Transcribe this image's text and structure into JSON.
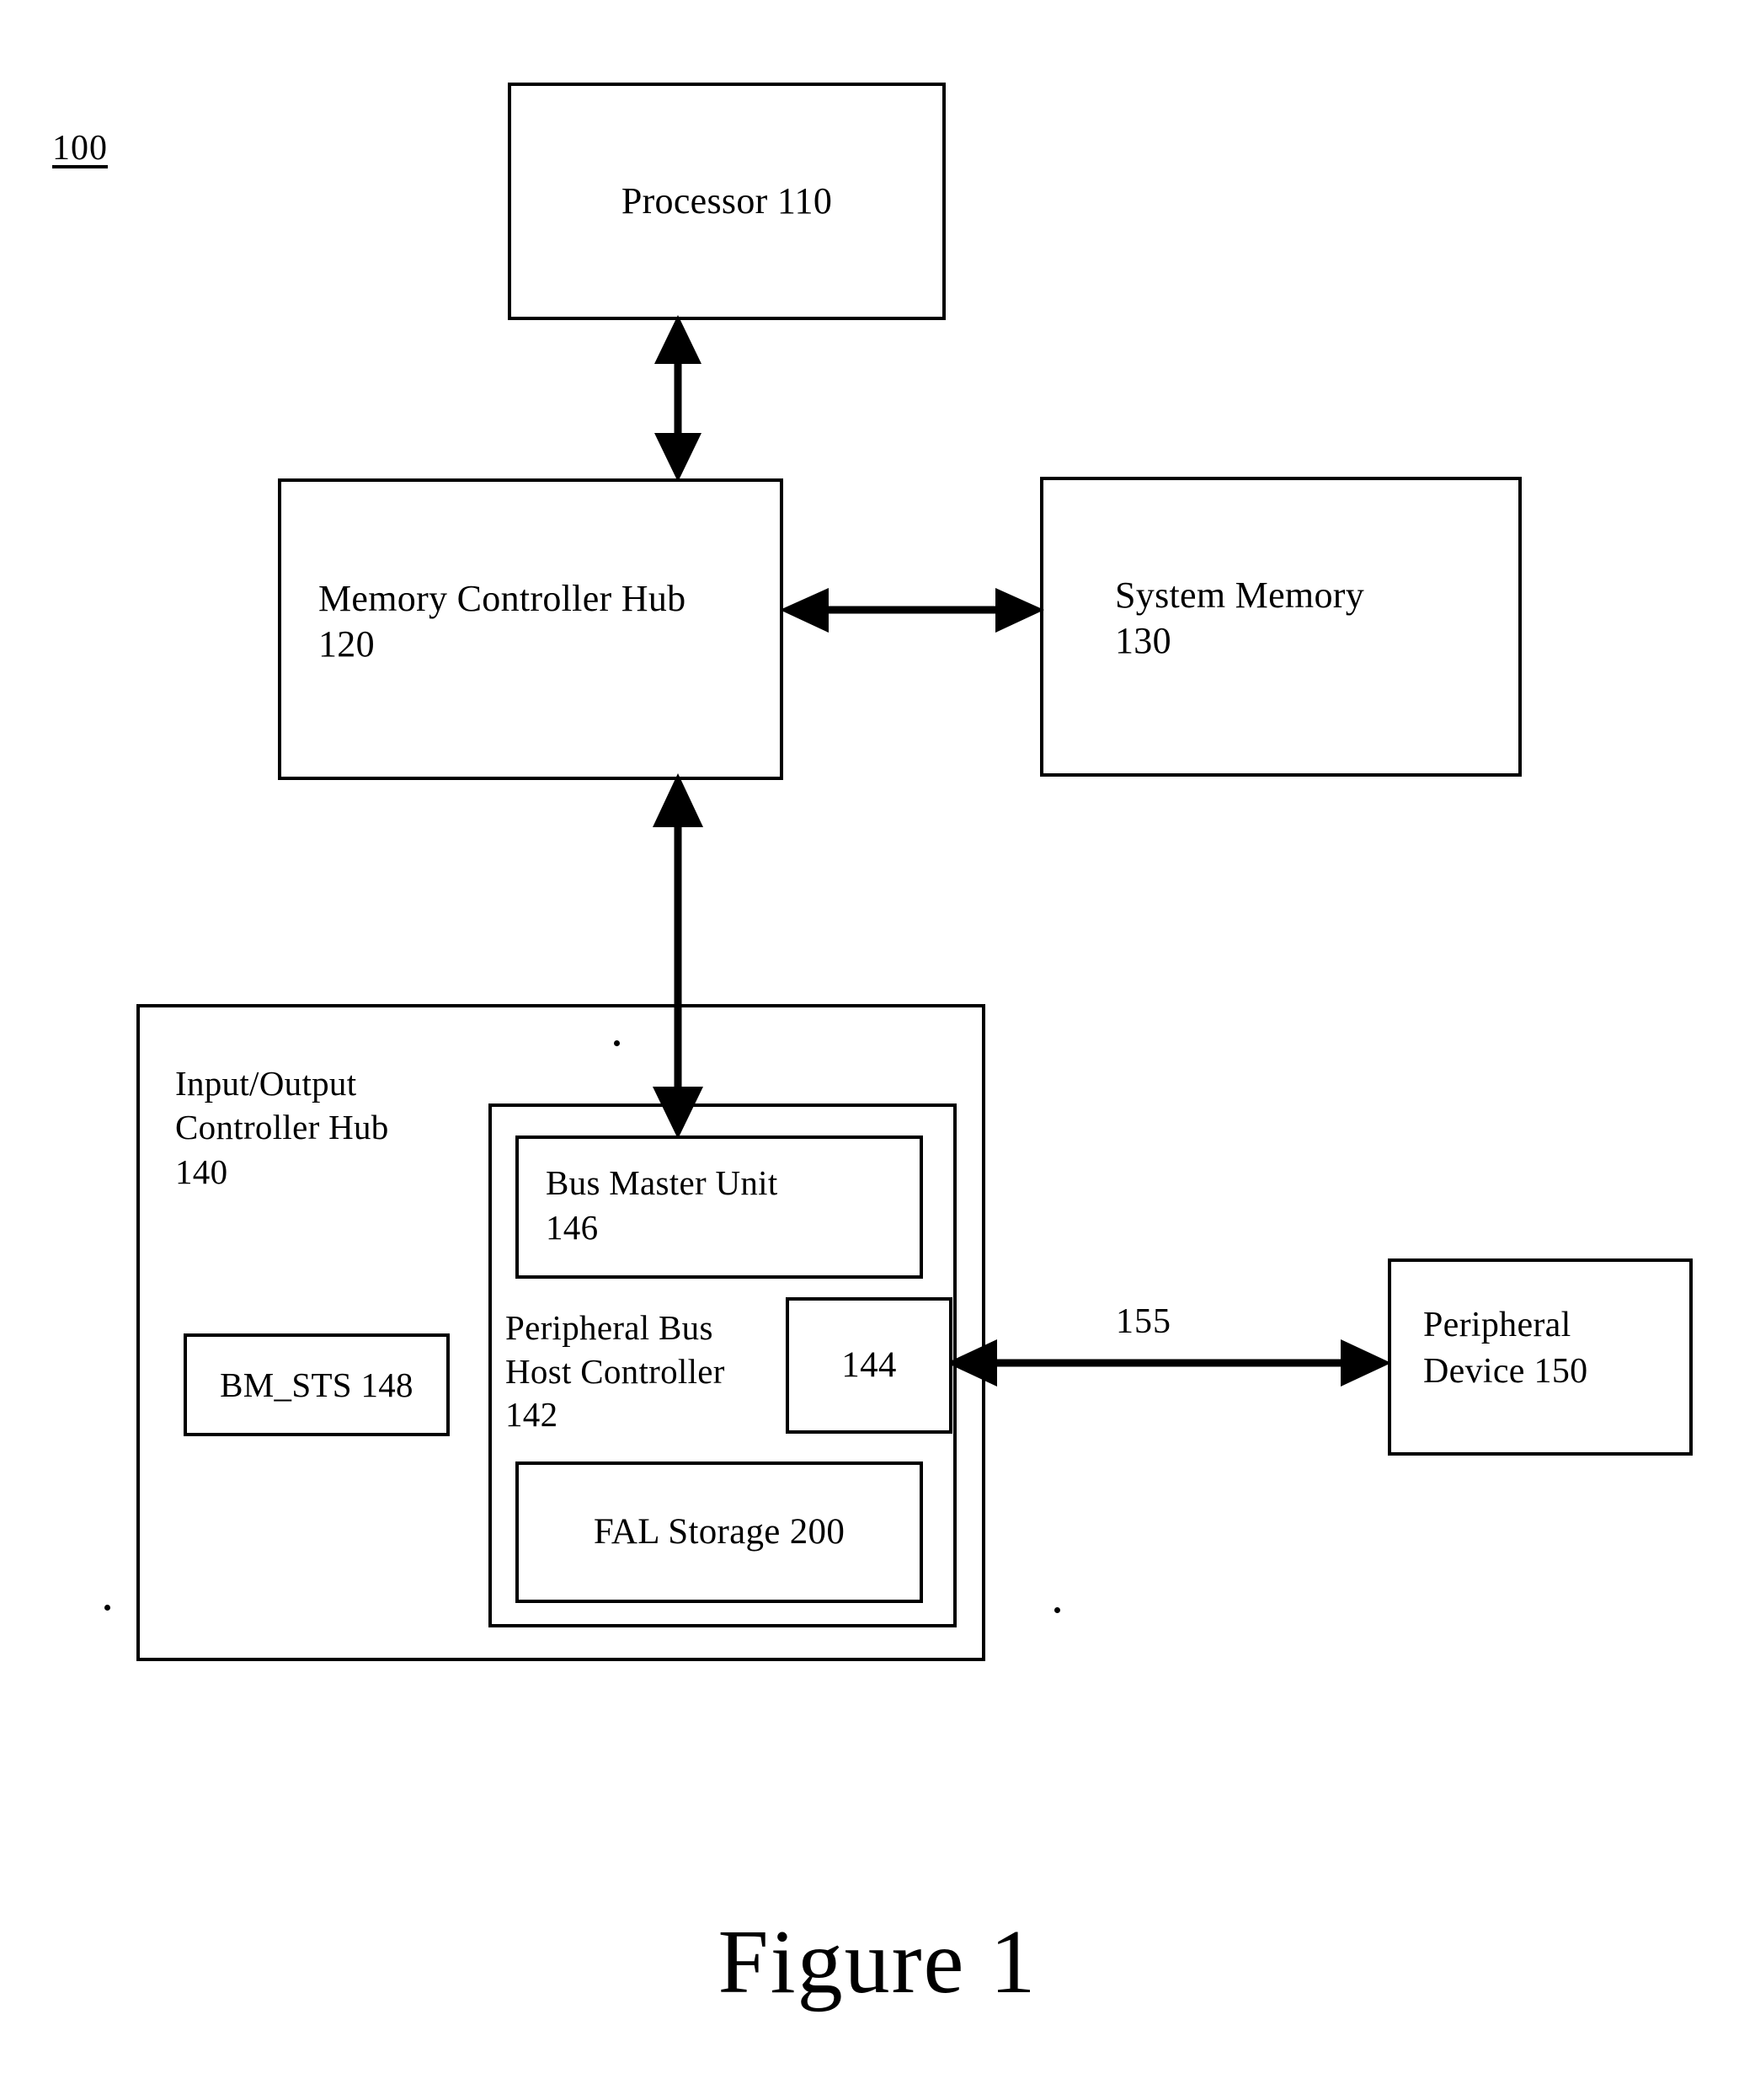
{
  "figure": {
    "number_label": "100",
    "caption": "Figure 1"
  },
  "blocks": {
    "processor": {
      "text": "Processor  110"
    },
    "memory_controller_hub": {
      "text": "Memory Controller Hub\n120"
    },
    "system_memory": {
      "text": "System Memory\n130"
    },
    "io_controller_hub": {
      "text": "Input/Output\nController Hub\n140"
    },
    "bm_sts": {
      "text": "BM_STS 148"
    },
    "peripheral_bus_host_controller": {
      "text": "Peripheral Bus\nHost Controller\n142"
    },
    "bus_master_unit": {
      "text": "Bus Master Unit\n146"
    },
    "port_144": {
      "text": "144"
    },
    "fal_storage": {
      "text": "FAL Storage 200"
    },
    "peripheral_device": {
      "text": "Peripheral\nDevice  150"
    }
  },
  "connectors": {
    "peripheral_bus_label": "155"
  },
  "colors": {
    "line": "#000000",
    "background": "#ffffff",
    "text": "#000000"
  }
}
